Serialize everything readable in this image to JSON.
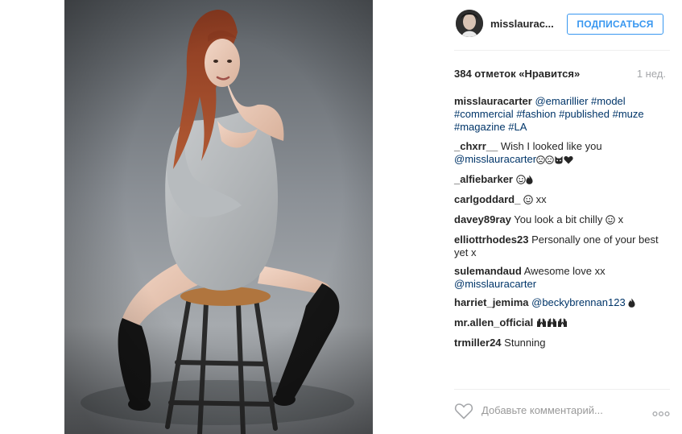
{
  "header": {
    "username": "misslaurac...",
    "follow_label": "ПОДПИСАТЬСЯ"
  },
  "post": {
    "likes": "384 отметок «Нравится»",
    "time": "1 нед."
  },
  "caption": {
    "user": "misslauracarter",
    "items": [
      "@emarillier",
      "#model",
      "#commercial",
      "#fashion",
      "#published",
      "#muze",
      "#magazine",
      "#LA"
    ]
  },
  "comments": [
    {
      "user": "_chxrr__",
      "text": "Wish I looked like you",
      "link": "@misslauracarter"
    },
    {
      "user": "_alfiebarker"
    },
    {
      "user": "carlgoddard_",
      "text": "xx"
    },
    {
      "user": "davey89ray",
      "text": "You look a bit chilly",
      "text_after": "x"
    },
    {
      "user": "elliottrhodes23",
      "text": "Personally one of your best yet x"
    },
    {
      "user": "sulemandaud",
      "text": "Awesome love xx",
      "link": "@misslauracarter"
    },
    {
      "user": "harriet_jemima",
      "link": "@beckybrennan123"
    },
    {
      "user": "mr.allen_official"
    },
    {
      "user": "trmiller24",
      "text": "Stunning"
    }
  ],
  "comment_box": {
    "placeholder": "Добавьте комментарий..."
  },
  "icons": {
    "like": "heart-outline-icon",
    "more": "ellipsis-icon"
  },
  "colors": {
    "accent": "#3897f0",
    "link": "#003569",
    "muted": "#a5a7aa",
    "text": "#262626"
  }
}
